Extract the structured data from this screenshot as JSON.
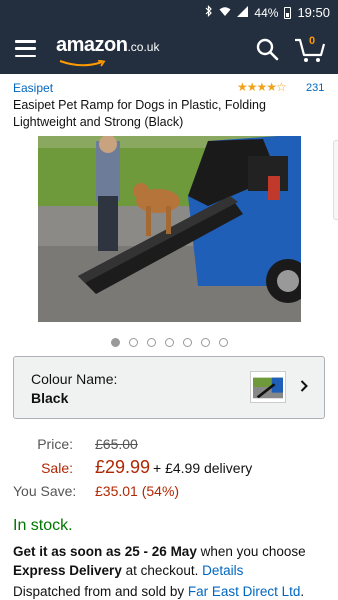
{
  "status_bar": {
    "battery": "44%",
    "time": "19:50"
  },
  "header": {
    "logo_text": "amazon",
    "logo_suffix": ".co.uk",
    "cart_count": "0",
    "icons": [
      "menu-icon",
      "search-icon",
      "cart-icon"
    ]
  },
  "product": {
    "brand": "Easipet",
    "stars": "★★★★☆",
    "rating": 4,
    "rating_count": "231",
    "title": "Easipet Pet Ramp for Dogs in Plastic, Folding Lightweight and Strong (Black)",
    "image_count": 7,
    "active_image": 1
  },
  "colour": {
    "label": "Colour Name:",
    "value": "Black"
  },
  "pricing": {
    "price_label": "Price:",
    "list_price": "£65.00",
    "sale_label": "Sale:",
    "sale_price": "£29.99",
    "delivery": "+ £4.99 delivery",
    "save_label": "You Save:",
    "save_value": "£35.01 (54%)"
  },
  "availability": {
    "stock": "In stock.",
    "get_it_prefix": "Get it as soon as 25 - 26 May",
    "get_it_middle": " when you choose ",
    "express": "Express Delivery",
    "at_checkout": " at checkout. ",
    "details_link": "Details",
    "dispatch_prefix": "Dispatched from and sold by ",
    "seller": "Far East Direct Ltd",
    "dispatch_suffix": "."
  },
  "colors": {
    "header_bg": "#232f3e",
    "link": "#0066c0",
    "price_red": "#b12704",
    "stock_green": "#007600",
    "star": "#f0a31a"
  }
}
